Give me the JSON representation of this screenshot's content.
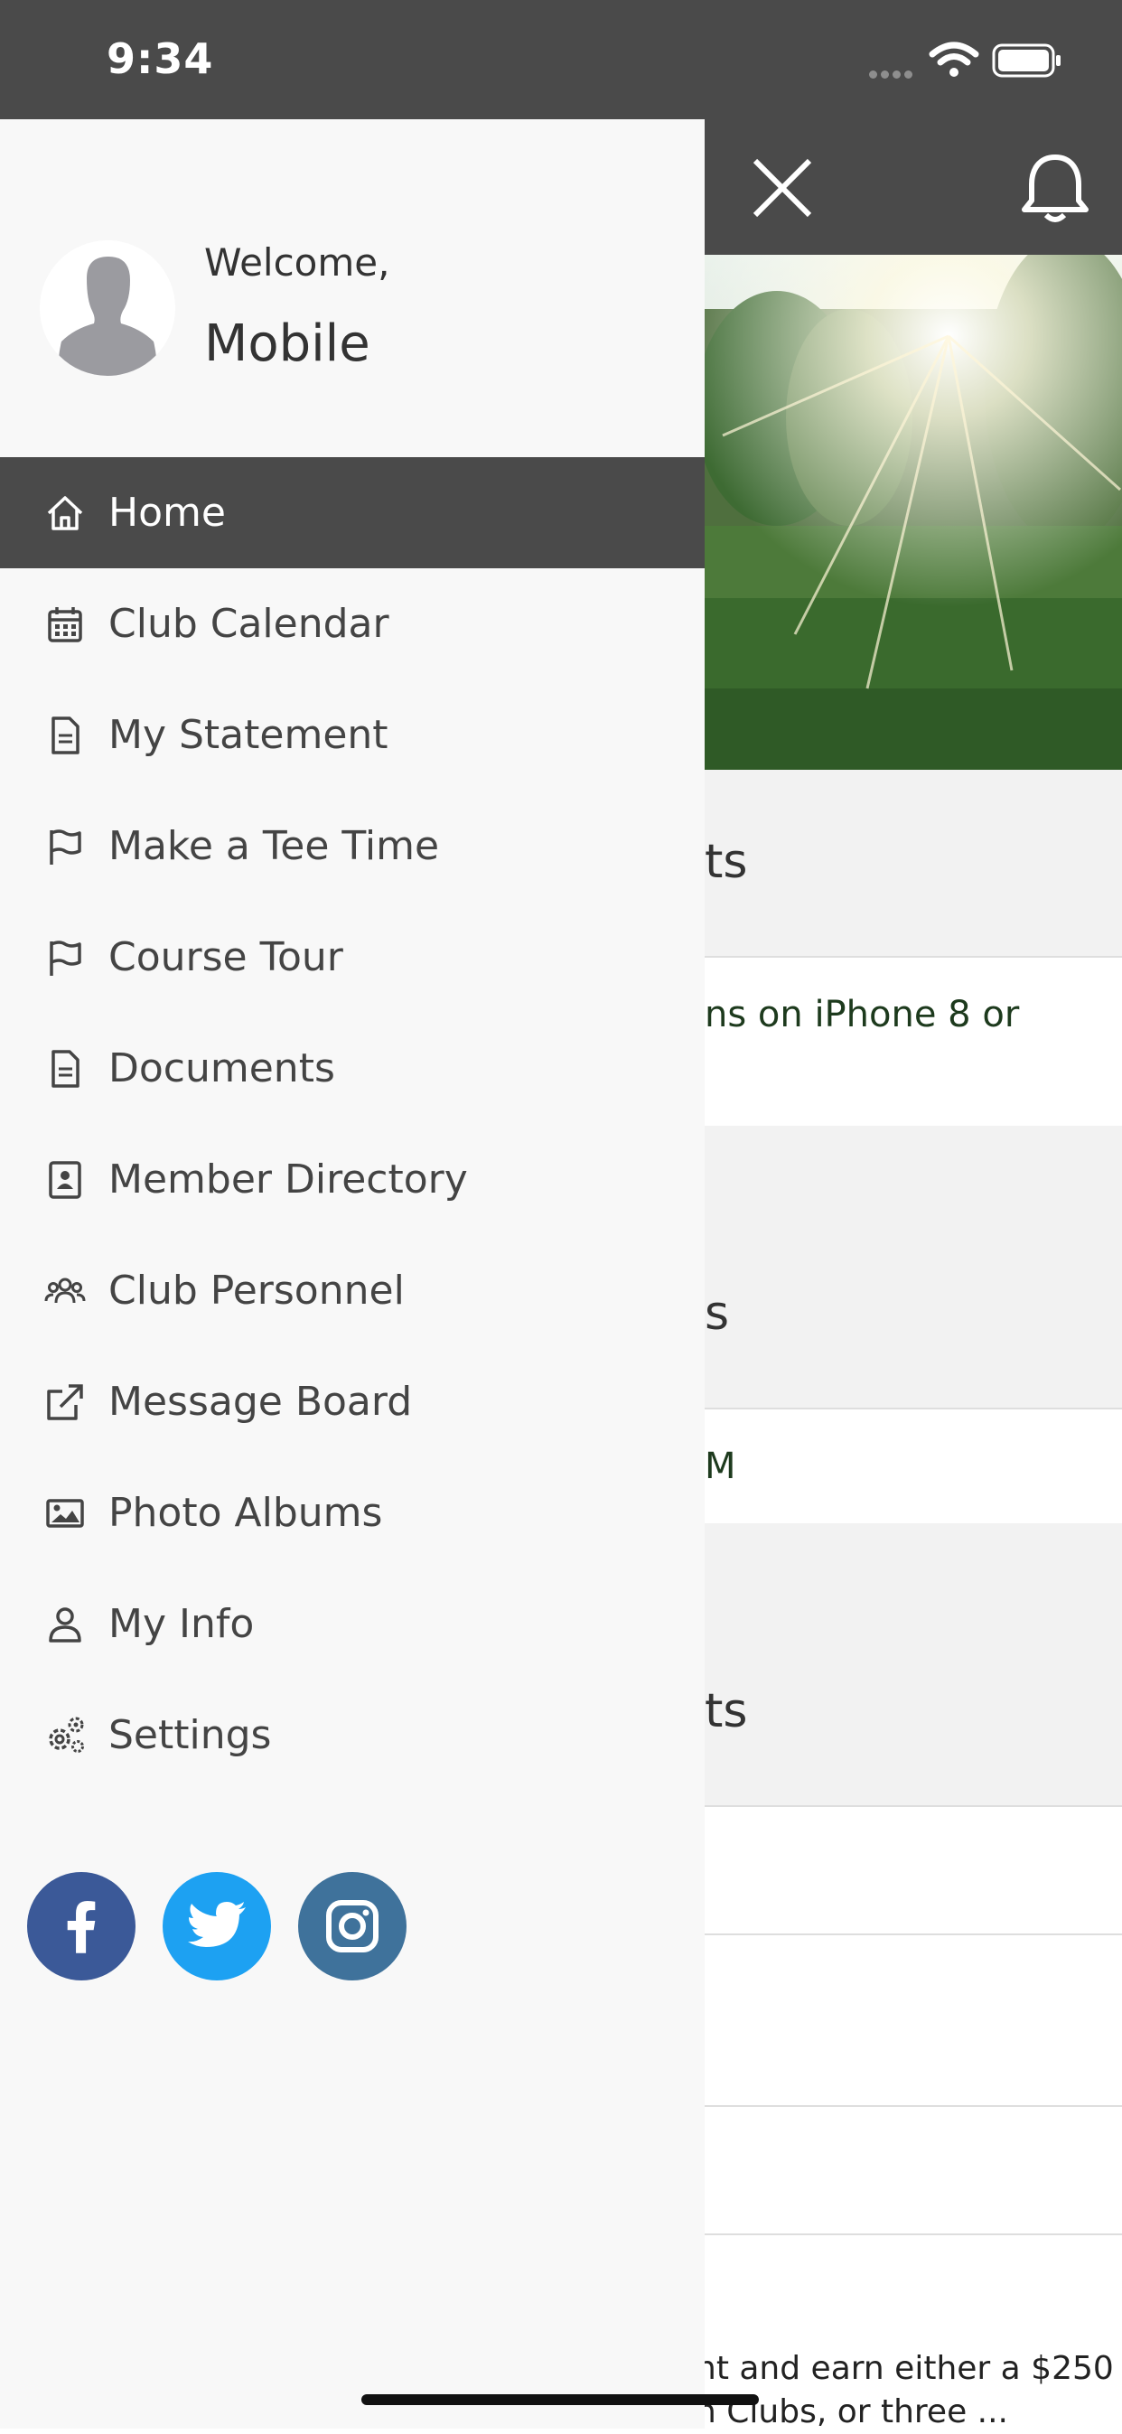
{
  "status_bar": {
    "time": "9:34"
  },
  "drawer": {
    "welcome": "Welcome,",
    "user_name": "Mobile",
    "menu": [
      {
        "label": "Home",
        "icon": "home-icon",
        "active": true
      },
      {
        "label": "Club Calendar",
        "icon": "calendar-icon"
      },
      {
        "label": "My Statement",
        "icon": "document-icon"
      },
      {
        "label": "Make a Tee Time",
        "icon": "flag-icon"
      },
      {
        "label": "Course Tour",
        "icon": "flag-icon"
      },
      {
        "label": "Documents",
        "icon": "document-icon"
      },
      {
        "label": "Member Directory",
        "icon": "contact-book-icon"
      },
      {
        "label": "Club Personnel",
        "icon": "users-icon"
      },
      {
        "label": "Message Board",
        "icon": "external-link-icon"
      },
      {
        "label": "Photo Albums",
        "icon": "image-icon"
      },
      {
        "label": "My Info",
        "icon": "user-icon"
      },
      {
        "label": "Settings",
        "icon": "gears-icon"
      }
    ],
    "social": [
      "facebook-icon",
      "twitter-icon",
      "instagram-icon"
    ]
  },
  "background": {
    "section_1": "ts",
    "row_1": "ns on iPhone 8 or",
    "section_2": "s",
    "row_2": "M",
    "section_3": "ts",
    "row_bottom_line1": "nt and earn either a $250",
    "row_bottom_line2": "n Clubs, or three ..."
  },
  "colors": {
    "header": "#4a4a4a",
    "drawer_bg": "#f8f8f8",
    "facebook": "#3b5998",
    "twitter": "#1da1f2",
    "instagram": "#3f729b",
    "link_text": "#1d3a1d"
  }
}
